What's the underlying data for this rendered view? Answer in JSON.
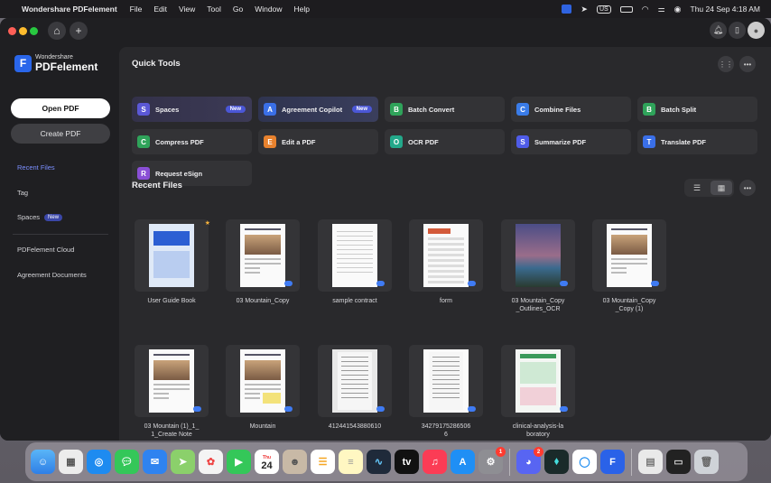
{
  "menubar": {
    "app_name": "Wondershare PDFelement",
    "menus": [
      "File",
      "Edit",
      "View",
      "Tool",
      "Go",
      "Window",
      "Help"
    ],
    "keyboard_layout": "US",
    "clock": "Thu 24 Sep  4:18 AM"
  },
  "sidebar": {
    "logo_small": "Wondershare",
    "logo_big": "PDFelement",
    "open_pdf": "Open PDF",
    "create_pdf": "Create PDF",
    "recent_files": "Recent Files",
    "tag": "Tag",
    "spaces": "Spaces",
    "spaces_badge": "New",
    "cloud": "PDFelement Cloud",
    "agreements": "Agreement Documents"
  },
  "quick_tools": {
    "title": "Quick Tools",
    "tools": [
      {
        "label": "Spaces",
        "badge": "New",
        "icon": "spaces-icon",
        "color": "#5b58d6"
      },
      {
        "label": "Agreement Copilot",
        "badge": "New",
        "icon": "copilot-icon",
        "color": "#3a6fe8"
      },
      {
        "label": "Batch Convert",
        "icon": "batch-convert-icon",
        "color": "#2fa35a"
      },
      {
        "label": "Combine Files",
        "icon": "combine-icon",
        "color": "#3a7ce8"
      },
      {
        "label": "Batch Split",
        "icon": "batch-split-icon",
        "color": "#2fa35a"
      },
      {
        "label": "Compress PDF",
        "icon": "compress-icon",
        "color": "#2fa35a"
      },
      {
        "label": "Edit a PDF",
        "icon": "edit-icon",
        "color": "#e8822e"
      },
      {
        "label": "OCR PDF",
        "icon": "ocr-icon",
        "color": "#23a88a"
      },
      {
        "label": "Summarize PDF",
        "icon": "summarize-icon",
        "color": "#4f5ce8"
      },
      {
        "label": "Translate PDF",
        "icon": "translate-icon",
        "color": "#3a6fe8"
      },
      {
        "label": "Request eSign",
        "icon": "esign-icon",
        "color": "#8a4fd6"
      }
    ]
  },
  "recent": {
    "title": "Recent Files",
    "files": [
      {
        "name": "User Guide Book"
      },
      {
        "name": "03 Mountain_Copy"
      },
      {
        "name": "sample contract"
      },
      {
        "name": "form"
      },
      {
        "name": "03 Mountain_Copy\n_Outlines_OCR"
      },
      {
        "name": "03 Mountain_Copy\n_Copy (1)"
      },
      {
        "name": "03 Mountain (1)_1_\n1_Create Note"
      },
      {
        "name": "Mountain"
      },
      {
        "name": "412441543880610"
      },
      {
        "name": "34279175286506\n6"
      },
      {
        "name": "clinical-analysis-la\nboratory"
      }
    ]
  },
  "dock": {
    "calendar_day": "24",
    "calendar_month": "Thu",
    "settings_badge": "1",
    "discord_badge": "2"
  }
}
